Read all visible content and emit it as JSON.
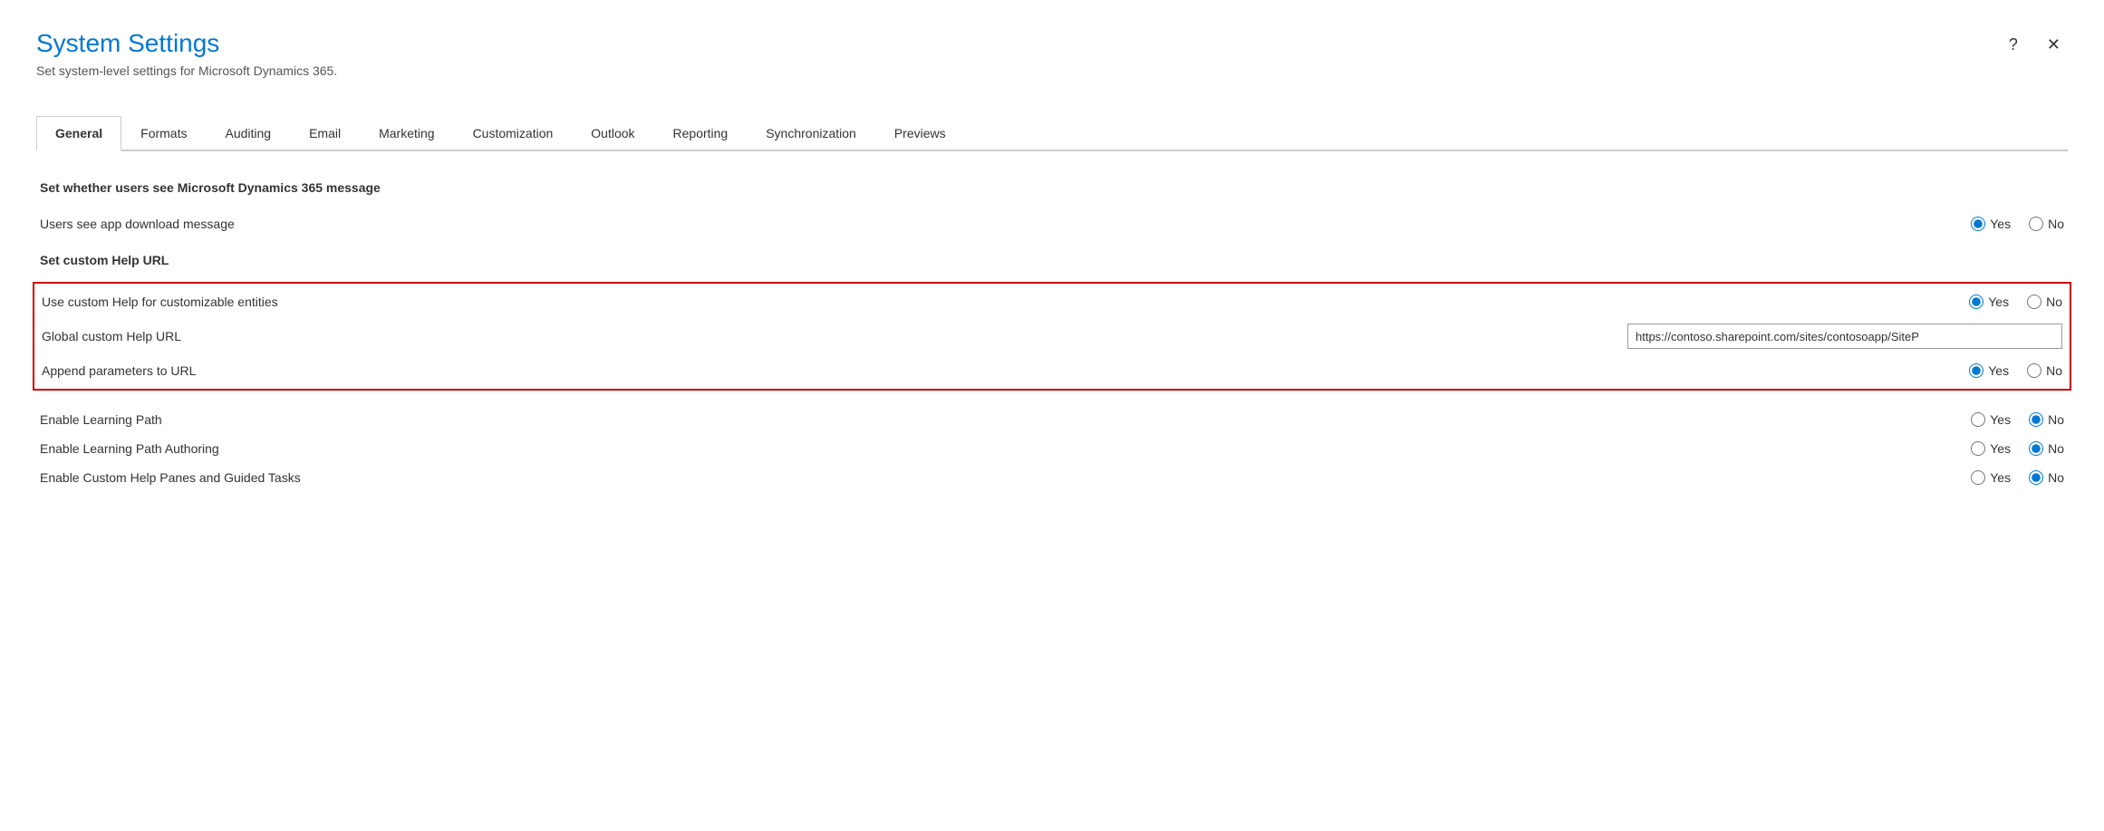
{
  "dialog": {
    "title": "System Settings",
    "subtitle": "Set system-level settings for Microsoft Dynamics 365.",
    "help_button": "?",
    "close_button": "✕"
  },
  "tabs": [
    {
      "id": "general",
      "label": "General",
      "active": true
    },
    {
      "id": "formats",
      "label": "Formats",
      "active": false
    },
    {
      "id": "auditing",
      "label": "Auditing",
      "active": false
    },
    {
      "id": "email",
      "label": "Email",
      "active": false
    },
    {
      "id": "marketing",
      "label": "Marketing",
      "active": false
    },
    {
      "id": "customization",
      "label": "Customization",
      "active": false
    },
    {
      "id": "outlook",
      "label": "Outlook",
      "active": false
    },
    {
      "id": "reporting",
      "label": "Reporting",
      "active": false
    },
    {
      "id": "synchronization",
      "label": "Synchronization",
      "active": false
    },
    {
      "id": "previews",
      "label": "Previews",
      "active": false
    }
  ],
  "sections": {
    "dynamics_message": {
      "title": "Set whether users see Microsoft Dynamics 365 message",
      "settings": [
        {
          "id": "app_download_message",
          "label": "Users see app download message",
          "value": "yes"
        }
      ]
    },
    "custom_help_url": {
      "title": "Set custom Help URL",
      "highlighted": true,
      "settings": [
        {
          "id": "use_custom_help",
          "label": "Use custom Help for customizable entities",
          "value": "yes"
        },
        {
          "id": "global_custom_help_url",
          "label": "Global custom Help URL",
          "type": "text",
          "value": "https://contoso.sharepoint.com/sites/contosoapp/SiteP"
        },
        {
          "id": "append_parameters",
          "label": "Append parameters to URL",
          "value": "yes"
        }
      ]
    },
    "learning_path": {
      "settings": [
        {
          "id": "enable_learning_path",
          "label": "Enable Learning Path",
          "value": "no"
        },
        {
          "id": "enable_learning_path_authoring",
          "label": "Enable Learning Path Authoring",
          "value": "no"
        },
        {
          "id": "enable_custom_help_panes",
          "label": "Enable Custom Help Panes and Guided Tasks",
          "value": "no"
        }
      ]
    }
  },
  "labels": {
    "yes": "Yes",
    "no": "No"
  }
}
